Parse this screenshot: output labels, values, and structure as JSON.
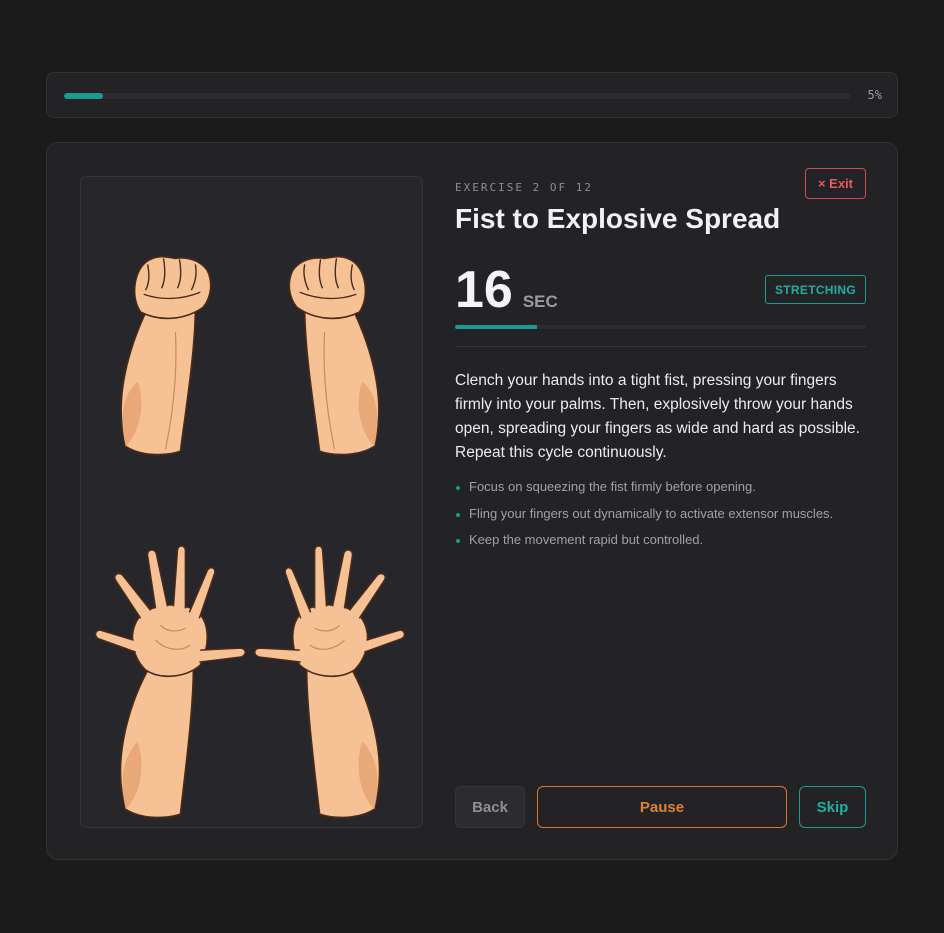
{
  "progress": {
    "percent_label": "5%",
    "fraction": 0.05
  },
  "exercise": {
    "counter": "EXERCISE 2 OF 12",
    "title": "Fist to Explosive Spread",
    "timer_value": "16",
    "timer_unit": "SEC",
    "timer_fraction": 0.2,
    "category": "STRETCHING",
    "description": "Clench your hands into a tight fist, pressing your fingers firmly into your palms. Then, explosively throw your hands open, spreading your fingers as wide and hard as possible. Repeat this cycle continuously.",
    "tips": [
      "Focus on squeezing the fist firmly before opening.",
      "Fling your fingers out dynamically to activate extensor muscles.",
      "Keep the movement rapid but controlled."
    ]
  },
  "buttons": {
    "exit": "× Exit",
    "back": "Back",
    "pause": "Pause",
    "skip": "Skip"
  },
  "colors": {
    "accent": "#1a9a90",
    "exit": "#d24b4b",
    "pause": "#d9782a",
    "skin": "#f5c195",
    "skin_shadow": "#e8a877"
  },
  "illustration": {
    "icons": [
      "left-fist-icon",
      "right-fist-icon",
      "left-open-hand-icon",
      "right-open-hand-icon"
    ]
  }
}
